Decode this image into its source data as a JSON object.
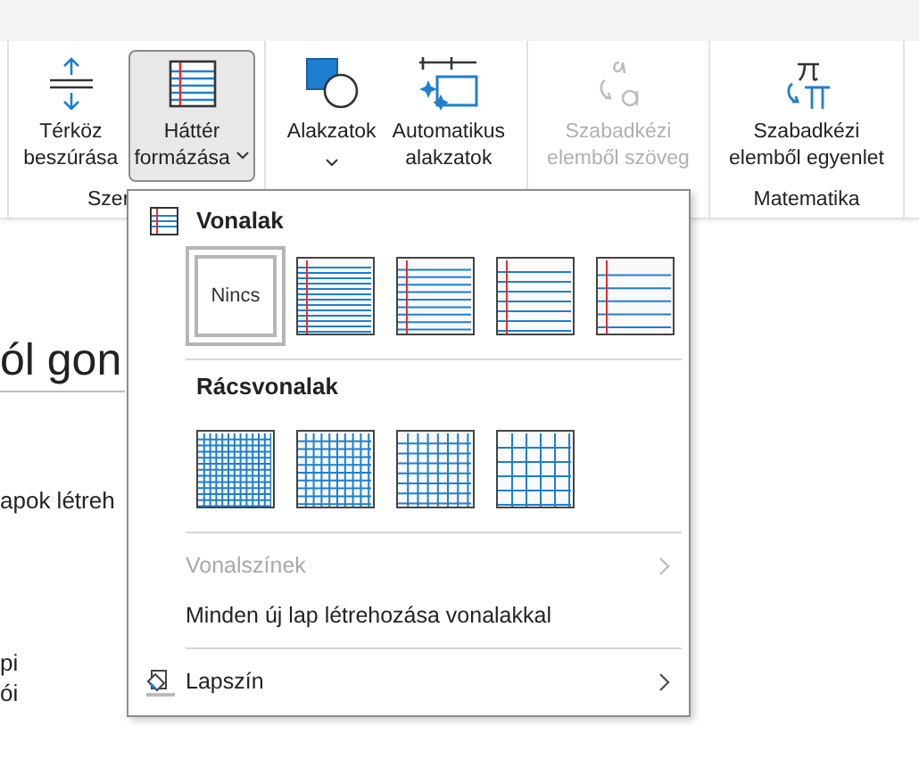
{
  "ribbon": {
    "groups": [
      {
        "label": "Szer",
        "buttons": [
          {
            "kind": "spacing",
            "lines": [
              "Térköz",
              "beszúrása"
            ],
            "pressed": false,
            "disabled": false,
            "caret": false
          },
          {
            "kind": "background",
            "lines": [
              "Háttér",
              "formázása"
            ],
            "pressed": true,
            "disabled": false,
            "caret": true
          }
        ]
      },
      {
        "buttons": [
          {
            "kind": "shapes",
            "lines": [
              "Alakzatok"
            ],
            "pressed": false,
            "disabled": false,
            "caret": true
          },
          {
            "kind": "autoshapes",
            "lines": [
              "Automatikus",
              "alakzatok"
            ],
            "pressed": false,
            "disabled": false,
            "caret": false
          }
        ]
      },
      {
        "buttons": [
          {
            "kind": "inktext",
            "lines": [
              "Szabadkézi",
              "elemből szöveg"
            ],
            "pressed": false,
            "disabled": true,
            "caret": false
          }
        ]
      },
      {
        "label": "Matematika",
        "buttons": [
          {
            "kind": "inkmath",
            "lines": [
              "Szabadkézi",
              "elemből egyenlet"
            ],
            "pressed": false,
            "disabled": false,
            "caret": false
          }
        ]
      }
    ]
  },
  "document": {
    "title": "ól gon",
    "lines": [
      "apok létreh",
      "pi",
      "ói"
    ]
  },
  "menu": {
    "rule_header": "Vonalak",
    "rule_options": [
      {
        "kind": "none",
        "label": "Nincs",
        "selected": true
      },
      {
        "kind": "narrow",
        "selected": false
      },
      {
        "kind": "college",
        "selected": false
      },
      {
        "kind": "standard",
        "selected": false
      },
      {
        "kind": "wide",
        "selected": false
      }
    ],
    "grid_header": "Rácsvonalak",
    "grid_options": [
      {
        "kind": "small",
        "selected": false
      },
      {
        "kind": "medium",
        "selected": false
      },
      {
        "kind": "large",
        "selected": false
      },
      {
        "kind": "xlarge",
        "selected": false
      }
    ],
    "items": [
      {
        "kind": "submenu",
        "label": "Vonalszínek",
        "disabled": true
      },
      {
        "kind": "command",
        "label": "Minden új lap létrehozása vonalakkal",
        "disabled": false
      },
      {
        "kind": "color",
        "label": "Lapszín",
        "disabled": false
      }
    ]
  }
}
